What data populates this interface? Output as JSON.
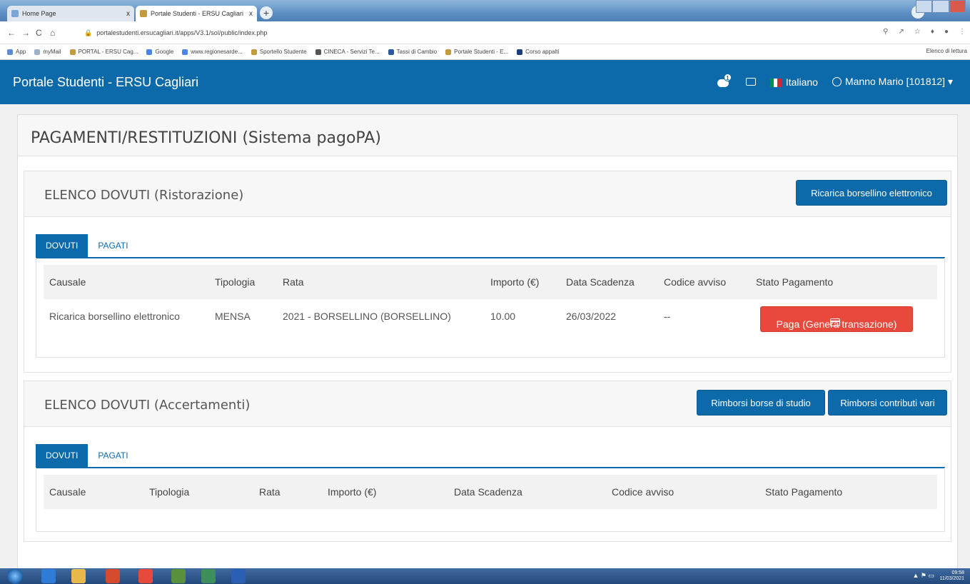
{
  "browser": {
    "tabs": [
      {
        "label": "Home Page",
        "close": "x"
      },
      {
        "label": "Portale Studenti - ERSU Cagliari",
        "close": "x"
      }
    ],
    "new_tab": "+",
    "url": "portalestudenti.ersucagliari.it/apps/V3.1/sol/public/index.php",
    "nav": {
      "back": "←",
      "forward": "→",
      "reload": "C",
      "home": "⌂"
    },
    "bookmarks": [
      "App",
      "myMail",
      "PORTAL - ERSU Cag...",
      "Google",
      "www.regionesarde...",
      "Sportello Studente",
      "CINECA - Servizi Te...",
      "Tassi di Cambio",
      "Portale Studenti - E...",
      "Corso appalti"
    ],
    "bookmarks_right": "Elenco di lettura"
  },
  "navbar": {
    "brand": "Portale Studenti - ERSU Cagliari",
    "notification_count": "1",
    "language": "Italiano",
    "user": "Manno Mario [101812]",
    "caret": "▾"
  },
  "page": {
    "title": "PAGAMENTI/RESTITUZIONI (Sistema pagoPA)"
  },
  "panel_ristorazione": {
    "title": "ELENCO DOVUTI (Ristorazione)",
    "button": "Ricarica borsellino elettronico",
    "tabs": [
      "DOVUTI",
      "PAGATI"
    ],
    "headers": [
      "Causale",
      "Tipologia",
      "Rata",
      "Importo (€)",
      "Data Scadenza",
      "Codice avviso",
      "Stato Pagamento"
    ],
    "rows": [
      {
        "causale": "Ricarica borsellino elettronico",
        "tipologia": "MENSA",
        "rata": "2021 - BORSELLINO (BORSELLINO)",
        "importo": "10.00",
        "scadenza": "26/03/2022",
        "codice": "--",
        "action": "Paga (Genera transazione)"
      }
    ]
  },
  "panel_accertamenti": {
    "title": "ELENCO DOVUTI (Accertamenti)",
    "button_borse": "Rimborsi borse di studio",
    "button_contributi": "Rimborsi contributi vari",
    "tabs": [
      "DOVUTI",
      "PAGATI"
    ],
    "headers": [
      "Causale",
      "Tipologia",
      "Rata",
      "Importo (€)",
      "Data Scadenza",
      "Codice avviso",
      "Stato Pagamento"
    ]
  },
  "taskbar": {
    "time": "09:58",
    "date": "11/03/2021"
  },
  "colors": {
    "primary": "#0d6aaa",
    "danger": "#e8493c"
  }
}
